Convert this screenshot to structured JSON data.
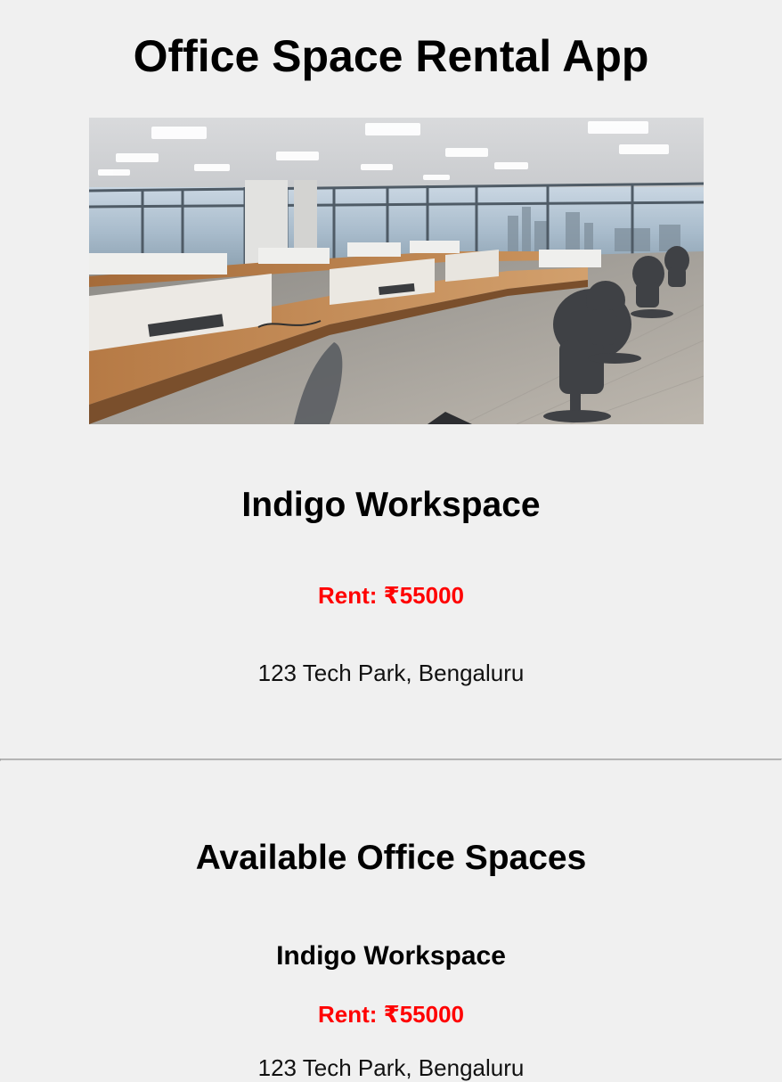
{
  "app": {
    "title": "Office Space Rental App"
  },
  "featured": {
    "image": "office-interior-photo",
    "name": "Indigo Workspace",
    "rent": "Rent: ₹55000",
    "address": "123 Tech Park, Bengaluru"
  },
  "listing_section": {
    "title": "Available Office Spaces",
    "items": [
      {
        "name": "Indigo Workspace",
        "rent": "Rent: ₹55000",
        "address": "123 Tech Park, Bengaluru"
      }
    ]
  },
  "colors": {
    "background": "#f0f0f0",
    "rent_low": "#ff0000",
    "rent_high": "#008000",
    "divider": "#b5b5b5"
  },
  "rent_threshold": 60000
}
